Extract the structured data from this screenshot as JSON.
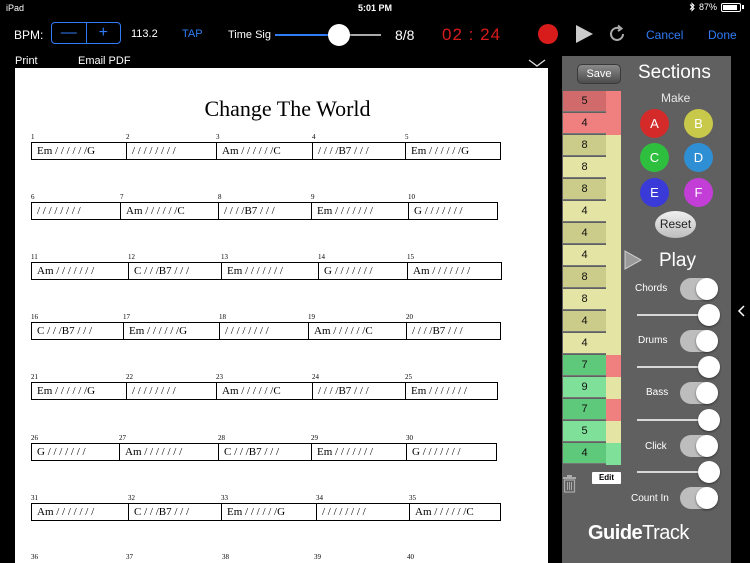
{
  "status_bar": {
    "device": "iPad",
    "time": "5:01 PM",
    "battery": "87%"
  },
  "toolbar": {
    "bpm_label": "BPM:",
    "bpm_value": "113.2",
    "tap_label": "TAP",
    "time_sig_label": "Time Sig",
    "time_sig_value": "8/8",
    "time_sig_slider_fraction": 0.6,
    "timer_minutes": "02",
    "timer_sep": ":",
    "timer_seconds": "24",
    "cancel_label": "Cancel",
    "done_label": "Done"
  },
  "doc_actions": {
    "print_label": "Print",
    "email_label": "Email PDF"
  },
  "sheet": {
    "title": "Change The World",
    "systems": [
      {
        "bars": [
          {
            "n": "1",
            "c": "Em / / / / / /G"
          },
          {
            "n": "2",
            "c": "/ / / / / / / /"
          },
          {
            "n": "3",
            "c": "Am / / / / / /C"
          },
          {
            "n": "4",
            "c": "/ / / /B7 / / /"
          },
          {
            "n": "5",
            "c": "Em / / / / / /G"
          }
        ]
      },
      {
        "bars": [
          {
            "n": "6",
            "c": "/ / / / / / / /"
          },
          {
            "n": "7",
            "c": "Am / / / / / /C"
          },
          {
            "n": "8",
            "c": "/ / / /B7 / / /"
          },
          {
            "n": "9",
            "c": "Em / / / / / / /"
          },
          {
            "n": "10",
            "c": "G / / / / / / /"
          }
        ]
      },
      {
        "bars": [
          {
            "n": "11",
            "c": "Am / / / / / / /"
          },
          {
            "n": "12",
            "c": "C / / /B7 / / /"
          },
          {
            "n": "13",
            "c": "Em / / / / / / /"
          },
          {
            "n": "14",
            "c": "G / / / / / / /"
          },
          {
            "n": "15",
            "c": "Am / / / / / / /"
          }
        ]
      },
      {
        "bars": [
          {
            "n": "16",
            "c": "C / / /B7 / / /"
          },
          {
            "n": "17",
            "c": "Em / / / / / /G"
          },
          {
            "n": "18",
            "c": "/ / / / / / / /"
          },
          {
            "n": "19",
            "c": "Am / / / / / /C"
          },
          {
            "n": "20",
            "c": "/ / / /B7 / / /"
          }
        ]
      },
      {
        "bars": [
          {
            "n": "21",
            "c": "Em / / / / / /G"
          },
          {
            "n": "22",
            "c": "/ / / / / / / /"
          },
          {
            "n": "23",
            "c": "Am / / / / / /C"
          },
          {
            "n": "24",
            "c": "/ / / /B7 / / /"
          },
          {
            "n": "25",
            "c": "Em / / / / / / /"
          }
        ]
      },
      {
        "bars": [
          {
            "n": "26",
            "c": "G / / / / / / /"
          },
          {
            "n": "27",
            "c": "Am / / / / / / /"
          },
          {
            "n": "28",
            "c": "C / / /B7 / / /"
          },
          {
            "n": "29",
            "c": "Em / / / / / / /"
          },
          {
            "n": "30",
            "c": "G / / / / / / /"
          }
        ]
      },
      {
        "bars": [
          {
            "n": "31",
            "c": "Am / / / / / / /"
          },
          {
            "n": "32",
            "c": "C / / /B7 / / /"
          },
          {
            "n": "33",
            "c": "Em / / / / / /G"
          },
          {
            "n": "34",
            "c": "/ / / / / / / /"
          },
          {
            "n": "35",
            "c": "Am / / / / / /C"
          }
        ]
      },
      {
        "bars": [
          {
            "n": "36",
            "c": ""
          },
          {
            "n": "37",
            "c": ""
          },
          {
            "n": "38",
            "c": ""
          },
          {
            "n": "39",
            "c": ""
          },
          {
            "n": "40",
            "c": ""
          }
        ]
      }
    ]
  },
  "panel": {
    "save_label": "Save",
    "sections_title": "Sections",
    "make_label": "Make",
    "section_buttons": [
      {
        "label": "A",
        "color": "#d42a2a"
      },
      {
        "label": "B",
        "color": "#c8c84a"
      },
      {
        "label": "C",
        "color": "#2fbf3f"
      },
      {
        "label": "D",
        "color": "#2f8fd4"
      },
      {
        "label": "E",
        "color": "#3a3ad8"
      },
      {
        "label": "F",
        "color": "#c33ed6"
      }
    ],
    "reset_label": "Reset",
    "play_title": "Play",
    "controls": {
      "chords_label": "Chords",
      "chords_on": true,
      "chords_volume": 0.9,
      "drums_label": "Drums",
      "drums_on": true,
      "drums_volume": 0.9,
      "bass_label": "Bass",
      "bass_on": true,
      "bass_volume": 0.9,
      "click_label": "Click",
      "click_on": true,
      "click_volume": 0.9,
      "count_in_label": "Count In",
      "count_in_on": true
    },
    "section_list": [
      {
        "value": "5",
        "color": "#d16b6b"
      },
      {
        "value": "4",
        "color": "#f08080"
      },
      {
        "value": "8",
        "color": "#cccc8a"
      },
      {
        "value": "8",
        "color": "#e4e4a4"
      },
      {
        "value": "8",
        "color": "#cccc8a"
      },
      {
        "value": "4",
        "color": "#e4e4a4"
      },
      {
        "value": "4",
        "color": "#cccc8a"
      },
      {
        "value": "4",
        "color": "#e4e4a4"
      },
      {
        "value": "8",
        "color": "#cccc8a"
      },
      {
        "value": "8",
        "color": "#e4e4a4"
      },
      {
        "value": "4",
        "color": "#cccc8a"
      },
      {
        "value": "4",
        "color": "#e4e4a4"
      },
      {
        "value": "7",
        "color": "#5ec97a"
      },
      {
        "value": "9",
        "color": "#7fe09a"
      },
      {
        "value": "7",
        "color": "#5ec97a"
      },
      {
        "value": "5",
        "color": "#7fe09a"
      },
      {
        "value": "4",
        "color": "#5ec97a"
      }
    ],
    "strip_colors": [
      "#f08080",
      "#e4e4a4",
      "#f08080",
      "#e4e4a4",
      "#f08080",
      "#e4e4a4",
      "#7fe09a"
    ],
    "edit_label": "Edit",
    "logo_bold": "Guide",
    "logo_light": "Track"
  }
}
